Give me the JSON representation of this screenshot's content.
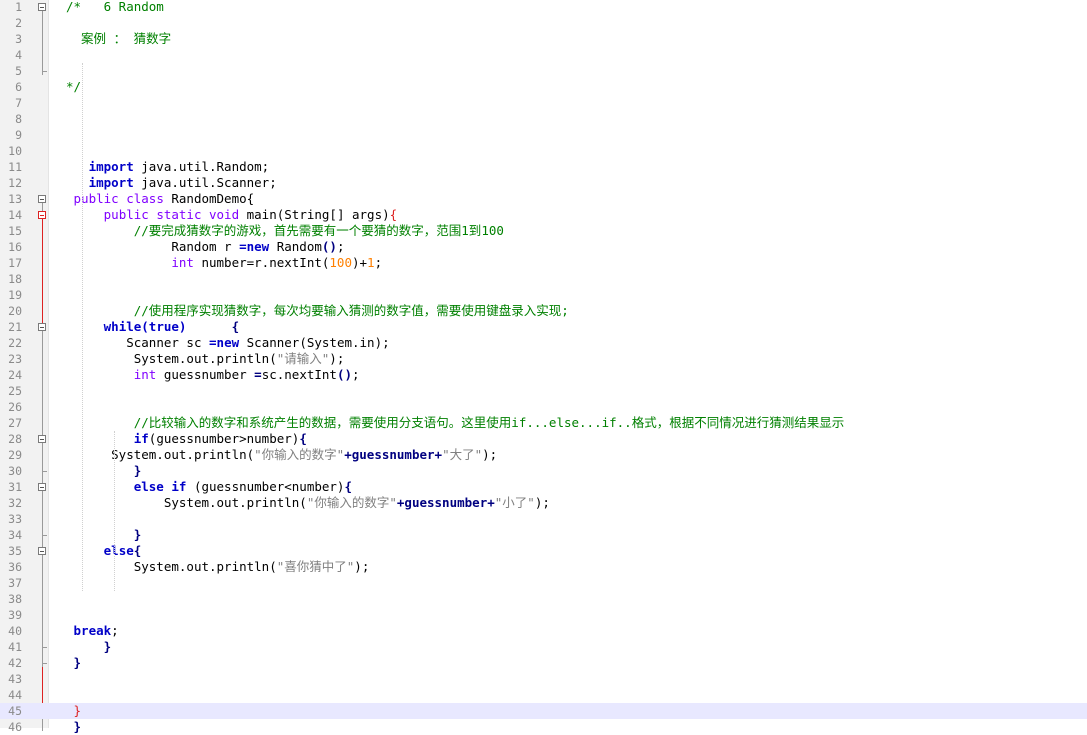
{
  "editor": {
    "language": "java",
    "current_line": 45,
    "colors": {
      "keyword": "#0000c8",
      "type": "#8000ff",
      "comment": "#008000",
      "string": "#808080",
      "number": "#ff8000",
      "operator": "#000080",
      "current_line_bg": "#e8e8ff",
      "gutter_bg": "#f2f2f2",
      "fold_marker_active": "#dd2222"
    },
    "lines": [
      {
        "n": "1",
        "tokens": [
          {
            "t": "/*   6 Random",
            "c": "cm"
          }
        ]
      },
      {
        "n": "2",
        "tokens": []
      },
      {
        "n": "3",
        "tokens": [
          {
            "t": "  案例 ： 猜数字",
            "c": "cm"
          }
        ]
      },
      {
        "n": "4",
        "tokens": []
      },
      {
        "n": "5",
        "tokens": []
      },
      {
        "n": "6",
        "tokens": [
          {
            "t": "*/",
            "c": "cm"
          }
        ]
      },
      {
        "n": "7",
        "tokens": []
      },
      {
        "n": "8",
        "tokens": []
      },
      {
        "n": "9",
        "tokens": []
      },
      {
        "n": "10",
        "tokens": []
      },
      {
        "n": "11",
        "tokens": [
          {
            "t": "   "
          },
          {
            "t": "import",
            "c": "kw"
          },
          {
            "t": " java.util.Random;",
            "c": "txt"
          }
        ]
      },
      {
        "n": "12",
        "tokens": [
          {
            "t": "   "
          },
          {
            "t": "import",
            "c": "kw"
          },
          {
            "t": " java.util.Scanner;",
            "c": "txt"
          }
        ]
      },
      {
        "n": "13",
        "tokens": [
          {
            "t": " "
          },
          {
            "t": "public class",
            "c": "type"
          },
          {
            "t": " RandomDemo{",
            "c": "txt"
          }
        ]
      },
      {
        "n": "14",
        "tokens": [
          {
            "t": "     "
          },
          {
            "t": "public static void",
            "c": "type"
          },
          {
            "t": " main(String[] args)",
            "c": "txt"
          },
          {
            "t": "{",
            "c": "red"
          }
        ]
      },
      {
        "n": "15",
        "tokens": [
          {
            "t": "         "
          },
          {
            "t": "//要完成猜数字的游戏，首先需要有一个要猜的数字，范围1到100",
            "c": "cm"
          }
        ]
      },
      {
        "n": "16",
        "tokens": [
          {
            "t": "              "
          },
          {
            "t": "Random r ",
            "c": "txt"
          },
          {
            "t": "=new",
            "c": "kw"
          },
          {
            "t": " Random",
            "c": "txt"
          },
          {
            "t": "()",
            "c": "op"
          },
          {
            "t": ";",
            "c": "txt"
          }
        ]
      },
      {
        "n": "17",
        "tokens": [
          {
            "t": "              "
          },
          {
            "t": "int",
            "c": "type"
          },
          {
            "t": " number=r.nextInt(",
            "c": "txt"
          },
          {
            "t": "100",
            "c": "num"
          },
          {
            "t": ")+",
            "c": "txt"
          },
          {
            "t": "1",
            "c": "num"
          },
          {
            "t": ";",
            "c": "txt"
          }
        ]
      },
      {
        "n": "18",
        "tokens": []
      },
      {
        "n": "19",
        "tokens": []
      },
      {
        "n": "20",
        "tokens": [
          {
            "t": "         "
          },
          {
            "t": "//使用程序实现猜数字，每次均要输入猜测的数字值，需要使用键盘录入实现;",
            "c": "cm"
          }
        ]
      },
      {
        "n": "21",
        "tokens": [
          {
            "t": "     "
          },
          {
            "t": "while(true)",
            "c": "kw"
          },
          {
            "t": "      {",
            "c": "op"
          }
        ]
      },
      {
        "n": "22",
        "tokens": [
          {
            "t": "        "
          },
          {
            "t": "Scanner sc ",
            "c": "txt"
          },
          {
            "t": "=new",
            "c": "kw"
          },
          {
            "t": " Scanner(System.in);",
            "c": "txt"
          }
        ]
      },
      {
        "n": "23",
        "tokens": [
          {
            "t": "         "
          },
          {
            "t": "System.out.println(",
            "c": "txt"
          },
          {
            "t": "\"请输入\"",
            "c": "str"
          },
          {
            "t": ");",
            "c": "txt"
          }
        ]
      },
      {
        "n": "24",
        "tokens": [
          {
            "t": "         "
          },
          {
            "t": "int",
            "c": "type"
          },
          {
            "t": " guessnumber ",
            "c": "txt"
          },
          {
            "t": "=",
            "c": "op"
          },
          {
            "t": "sc.nextInt",
            "c": "txt"
          },
          {
            "t": "()",
            "c": "op"
          },
          {
            "t": ";",
            "c": "txt"
          }
        ]
      },
      {
        "n": "25",
        "tokens": []
      },
      {
        "n": "26",
        "tokens": []
      },
      {
        "n": "27",
        "tokens": [
          {
            "t": "         "
          },
          {
            "t": "//比较输入的数字和系统产生的数据，需要使用分支语句。这里使用if...else...if..格式，根据不同情况进行猜测结果显示",
            "c": "cm"
          }
        ]
      },
      {
        "n": "28",
        "tokens": [
          {
            "t": "         "
          },
          {
            "t": "if",
            "c": "kw"
          },
          {
            "t": "(guessnumber>number)",
            "c": "txt"
          },
          {
            "t": "{",
            "c": "op"
          }
        ]
      },
      {
        "n": "29",
        "tokens": [
          {
            "t": "      "
          },
          {
            "t": "System.out.println(",
            "c": "txt"
          },
          {
            "t": "\"你输入的数字\"",
            "c": "str"
          },
          {
            "t": "+guessnumber+",
            "c": "op"
          },
          {
            "t": "\"大了\"",
            "c": "str"
          },
          {
            "t": ");",
            "c": "txt"
          }
        ]
      },
      {
        "n": "30",
        "tokens": [
          {
            "t": "         "
          },
          {
            "t": "}",
            "c": "op"
          }
        ]
      },
      {
        "n": "31",
        "tokens": [
          {
            "t": "         "
          },
          {
            "t": "else if",
            "c": "kw"
          },
          {
            "t": " (guessnumber<number)",
            "c": "txt"
          },
          {
            "t": "{",
            "c": "op"
          }
        ]
      },
      {
        "n": "32",
        "tokens": [
          {
            "t": "             "
          },
          {
            "t": "System.out.println(",
            "c": "txt"
          },
          {
            "t": "\"你输入的数字\"",
            "c": "str"
          },
          {
            "t": "+guessnumber+",
            "c": "op"
          },
          {
            "t": "\"小了\"",
            "c": "str"
          },
          {
            "t": ");",
            "c": "txt"
          }
        ]
      },
      {
        "n": "33",
        "tokens": []
      },
      {
        "n": "34",
        "tokens": [
          {
            "t": "         "
          },
          {
            "t": "}",
            "c": "op"
          }
        ]
      },
      {
        "n": "35",
        "tokens": [
          {
            "t": "     "
          },
          {
            "t": "else",
            "c": "kw"
          },
          {
            "t": "{",
            "c": "op"
          }
        ]
      },
      {
        "n": "36",
        "tokens": [
          {
            "t": "         "
          },
          {
            "t": "System.out.println(",
            "c": "txt"
          },
          {
            "t": "\"喜你猜中了\"",
            "c": "str"
          },
          {
            "t": ");",
            "c": "txt"
          }
        ]
      },
      {
        "n": "37",
        "tokens": []
      },
      {
        "n": "38",
        "tokens": []
      },
      {
        "n": "39",
        "tokens": []
      },
      {
        "n": "40",
        "tokens": [
          {
            "t": " "
          },
          {
            "t": "break",
            "c": "kw"
          },
          {
            "t": ";",
            "c": "txt"
          }
        ]
      },
      {
        "n": "41",
        "tokens": [
          {
            "t": "     "
          },
          {
            "t": "}",
            "c": "op"
          }
        ]
      },
      {
        "n": "42",
        "tokens": [
          {
            "t": " "
          },
          {
            "t": "}",
            "c": "op"
          }
        ]
      },
      {
        "n": "43",
        "tokens": []
      },
      {
        "n": "44",
        "tokens": []
      },
      {
        "n": "45",
        "tokens": [
          {
            "t": " "
          },
          {
            "t": "}",
            "c": "red"
          }
        ]
      },
      {
        "n": "46",
        "tokens": [
          {
            "t": " "
          },
          {
            "t": "}",
            "c": "op"
          }
        ]
      }
    ]
  }
}
